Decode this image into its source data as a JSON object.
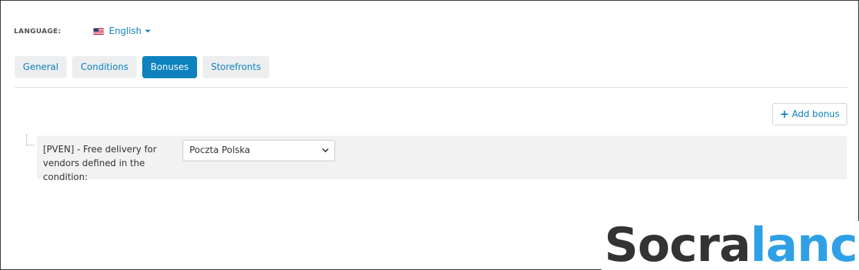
{
  "language": {
    "label": "LANGUAGE:",
    "value": "English",
    "flag_icon": "us-flag-icon"
  },
  "tabs": [
    {
      "label": "General",
      "active": false
    },
    {
      "label": "Conditions",
      "active": false
    },
    {
      "label": "Bonuses",
      "active": true
    },
    {
      "label": "Storefronts",
      "active": false
    }
  ],
  "toolbar": {
    "add_bonus_label": "Add bonus",
    "add_icon": "plus-icon"
  },
  "bonus": {
    "text": "[PVEN] - Free delivery for vendors defined in the condition:",
    "select_value": "Poczta Polska"
  },
  "watermark": {
    "part1": "Socra",
    "part2": "lance"
  },
  "colors": {
    "accent": "#0d82bf",
    "tab_bg": "#eceeef",
    "row_bg": "#f2f2f2",
    "watermark_dark": "#333333",
    "watermark_blue": "#2fa0e6"
  }
}
